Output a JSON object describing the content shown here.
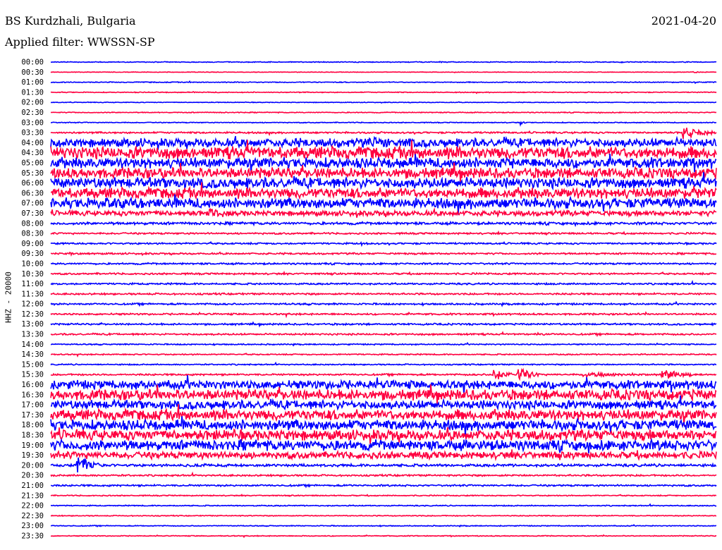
{
  "header": {
    "station": "BS Kurdzhali, Bulgaria",
    "date": "2021-04-20",
    "filter": "Applied filter: WWSSN-SP"
  },
  "chart_data": {
    "type": "line",
    "title": "BS Kurdzhali, Bulgaria",
    "ylabel": "HHZ - 20000",
    "xlabel": "",
    "minutes_per_line": 30,
    "colors": {
      "blue": "#0000ff",
      "red": "#ff0040"
    },
    "rows": [
      {
        "time": "00:00",
        "color": "blue",
        "noise": 0.5,
        "events": []
      },
      {
        "time": "00:30",
        "color": "red",
        "noise": 0.3,
        "events": [
          {
            "minute": 29,
            "amp": 1.5,
            "dur": 1
          }
        ]
      },
      {
        "time": "01:00",
        "color": "blue",
        "noise": 0.5,
        "events": []
      },
      {
        "time": "01:30",
        "color": "red",
        "noise": 0.5,
        "events": []
      },
      {
        "time": "02:00",
        "color": "blue",
        "noise": 0.4,
        "events": []
      },
      {
        "time": "02:30",
        "color": "red",
        "noise": 0.5,
        "events": []
      },
      {
        "time": "03:00",
        "color": "blue",
        "noise": 0.5,
        "events": [
          {
            "minute": 21.2,
            "amp": 5,
            "dur": 0.2
          }
        ]
      },
      {
        "time": "03:30",
        "color": "red",
        "noise": 1,
        "events": [
          {
            "minute": 28.5,
            "amp": 14,
            "dur": 1.5
          }
        ]
      },
      {
        "time": "04:00",
        "color": "blue",
        "noise": 5,
        "events": [
          {
            "minute": 0.3,
            "amp": 9,
            "dur": 0.6
          },
          {
            "minute": 14.5,
            "amp": 10,
            "dur": 2
          }
        ]
      },
      {
        "time": "04:30",
        "color": "red",
        "noise": 7,
        "events": []
      },
      {
        "time": "05:00",
        "color": "blue",
        "noise": 6,
        "events": [
          {
            "minute": 20.2,
            "amp": 9,
            "dur": 0.6
          }
        ]
      },
      {
        "time": "05:30",
        "color": "red",
        "noise": 6,
        "events": []
      },
      {
        "time": "06:00",
        "color": "blue",
        "noise": 6,
        "events": []
      },
      {
        "time": "06:30",
        "color": "red",
        "noise": 6,
        "events": [
          {
            "minute": 29,
            "amp": 12,
            "dur": 1
          }
        ]
      },
      {
        "time": "07:00",
        "color": "blue",
        "noise": 6,
        "events": [
          {
            "minute": 2.5,
            "amp": 9,
            "dur": 3
          }
        ]
      },
      {
        "time": "07:30",
        "color": "red",
        "noise": 3,
        "events": [
          {
            "minute": 7.2,
            "amp": 11,
            "dur": 0.8
          }
        ]
      },
      {
        "time": "08:00",
        "color": "blue",
        "noise": 1.5,
        "events": []
      },
      {
        "time": "08:30",
        "color": "red",
        "noise": 1,
        "events": []
      },
      {
        "time": "09:00",
        "color": "blue",
        "noise": 1,
        "events": [
          {
            "minute": 14,
            "amp": 3,
            "dur": 0.3
          }
        ]
      },
      {
        "time": "09:30",
        "color": "red",
        "noise": 1,
        "events": [
          {
            "minute": 0.9,
            "amp": 3,
            "dur": 0.8
          }
        ]
      },
      {
        "time": "10:00",
        "color": "blue",
        "noise": 1,
        "events": []
      },
      {
        "time": "10:30",
        "color": "red",
        "noise": 1,
        "events": []
      },
      {
        "time": "11:00",
        "color": "blue",
        "noise": 1,
        "events": []
      },
      {
        "time": "11:30",
        "color": "red",
        "noise": 1,
        "events": []
      },
      {
        "time": "12:00",
        "color": "blue",
        "noise": 1,
        "events": []
      },
      {
        "time": "12:30",
        "color": "red",
        "noise": 1,
        "events": []
      },
      {
        "time": "13:00",
        "color": "blue",
        "noise": 1,
        "events": []
      },
      {
        "time": "13:30",
        "color": "red",
        "noise": 1,
        "events": [
          {
            "minute": 22,
            "amp": 3,
            "dur": 0.4
          }
        ]
      },
      {
        "time": "14:00",
        "color": "blue",
        "noise": 0.7,
        "events": []
      },
      {
        "time": "14:30",
        "color": "red",
        "noise": 0.7,
        "events": [
          {
            "minute": 3.7,
            "amp": 3,
            "dur": 0.3
          }
        ]
      },
      {
        "time": "15:00",
        "color": "blue",
        "noise": 0.7,
        "events": []
      },
      {
        "time": "15:30",
        "color": "red",
        "noise": 1,
        "events": [
          {
            "minute": 20,
            "amp": 8,
            "dur": 2
          },
          {
            "minute": 21.1,
            "amp": 14,
            "dur": 1
          },
          {
            "minute": 24,
            "amp": 4,
            "dur": 5
          },
          {
            "minute": 27.5,
            "amp": 14,
            "dur": 1.5
          }
        ]
      },
      {
        "time": "16:00",
        "color": "blue",
        "noise": 5,
        "events": []
      },
      {
        "time": "16:30",
        "color": "red",
        "noise": 6,
        "events": []
      },
      {
        "time": "17:00",
        "color": "blue",
        "noise": 5,
        "events": []
      },
      {
        "time": "17:30",
        "color": "red",
        "noise": 6,
        "events": []
      },
      {
        "time": "18:00",
        "color": "blue",
        "noise": 6,
        "events": []
      },
      {
        "time": "18:30",
        "color": "red",
        "noise": 6,
        "events": []
      },
      {
        "time": "19:00",
        "color": "blue",
        "noise": 6,
        "events": []
      },
      {
        "time": "19:30",
        "color": "red",
        "noise": 4,
        "events": []
      },
      {
        "time": "20:00",
        "color": "blue",
        "noise": 1.5,
        "events": [
          {
            "minute": 1.2,
            "amp": 18,
            "dur": 1.2
          },
          {
            "minute": 6,
            "amp": 3,
            "dur": 7
          }
        ]
      },
      {
        "time": "20:30",
        "color": "red",
        "noise": 1,
        "events": []
      },
      {
        "time": "21:00",
        "color": "blue",
        "noise": 1,
        "events": [
          {
            "minute": 13.5,
            "amp": 2,
            "dur": 0.4
          }
        ]
      },
      {
        "time": "21:30",
        "color": "red",
        "noise": 0.6,
        "events": []
      },
      {
        "time": "22:00",
        "color": "blue",
        "noise": 0.6,
        "events": []
      },
      {
        "time": "22:30",
        "color": "red",
        "noise": 0.5,
        "events": []
      },
      {
        "time": "23:00",
        "color": "blue",
        "noise": 0.5,
        "events": []
      },
      {
        "time": "23:30",
        "color": "red",
        "noise": 0.5,
        "events": []
      }
    ]
  }
}
